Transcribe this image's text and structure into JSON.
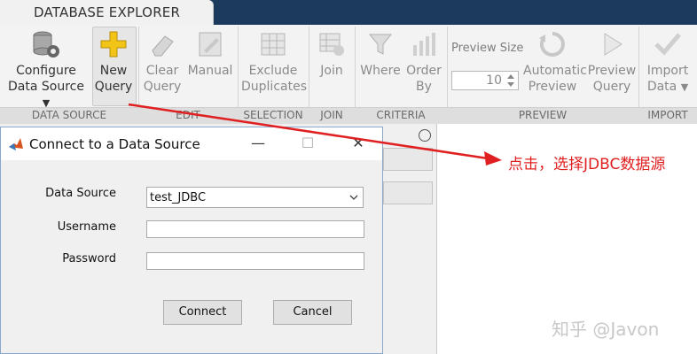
{
  "app": {
    "tab_title": "DATABASE EXPLORER"
  },
  "ribbon": {
    "data_source": {
      "configure_l1": "Configure",
      "configure_l2": "Data Source",
      "new_l1": "New",
      "new_l2": "Query",
      "group": "DATA SOURCE"
    },
    "edit": {
      "clear_l1": "Clear",
      "clear_l2": "Query",
      "manual": "Manual",
      "group": "EDIT"
    },
    "selection": {
      "exclude_l1": "Exclude",
      "exclude_l2": "Duplicates",
      "group": "SELECTION"
    },
    "join": {
      "join": "Join",
      "group": "JOIN"
    },
    "criteria": {
      "where": "Where",
      "order_l1": "Order",
      "order_l2": "By",
      "group": "CRITERIA"
    },
    "preview": {
      "size_label": "Preview Size",
      "size_value": "10",
      "auto_l1": "Automatic",
      "auto_l2": "Preview",
      "prev_l1": "Preview",
      "prev_l2": "Query",
      "group": "PREVIEW"
    },
    "import": {
      "import_l1": "Import",
      "import_l2": "Data",
      "group": "IMPORT"
    }
  },
  "dialog": {
    "title": "Connect to a Data Source",
    "data_source_label": "Data Source",
    "data_source_value": "test_JDBC",
    "username_label": "Username",
    "password_label": "Password",
    "connect": "Connect",
    "cancel": "Cancel"
  },
  "annotation": {
    "text": "点击，选择JDBC数据源",
    "color": "#e02020"
  },
  "watermark": "知乎 @Javon",
  "colors": {
    "topbar": "#1b3a5e",
    "ribbon": "#f3f3f3",
    "accent_red": "#e02020",
    "new_query_icon": "#f2c417"
  }
}
